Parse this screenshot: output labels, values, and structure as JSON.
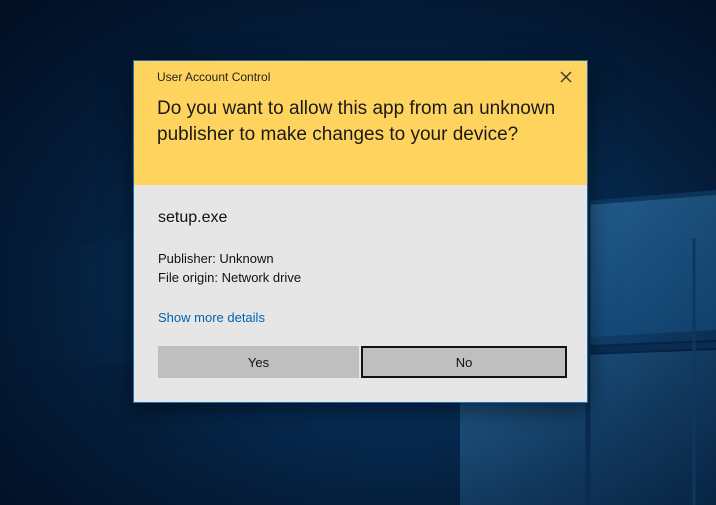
{
  "dialog": {
    "window_title": "User Account Control",
    "question": "Do you want to allow this app from an unknown publisher to make changes to your device?",
    "app_name": "setup.exe",
    "publisher_line": "Publisher: Unknown",
    "origin_line": "File origin: Network drive",
    "details_link": "Show more details",
    "yes_label": "Yes",
    "no_label": "No",
    "close_icon": "close-icon"
  },
  "colors": {
    "header_background": "#ffd45e",
    "dialog_background": "#e6e6e6",
    "button_background": "#bfbfbf",
    "link": "#0063b1",
    "dialog_border": "#1f6fb8",
    "desktop_background": "#07305a"
  }
}
